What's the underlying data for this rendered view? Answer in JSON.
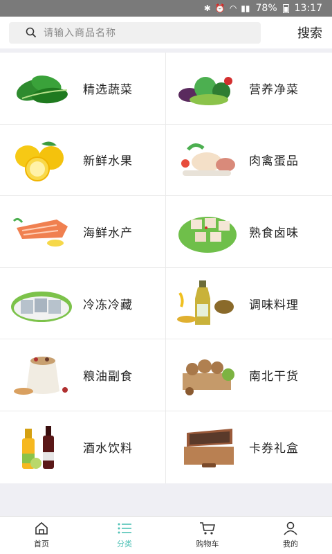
{
  "status_bar": {
    "battery": "78%",
    "time": "13:17"
  },
  "search": {
    "placeholder": "请输入商品名称",
    "button_label": "搜索"
  },
  "categories": [
    {
      "label": "精选蔬菜",
      "icon": "spinach-icon"
    },
    {
      "label": "营养净菜",
      "icon": "mixed-vegetables-icon"
    },
    {
      "label": "新鲜水果",
      "icon": "lemon-icon"
    },
    {
      "label": "肉禽蛋品",
      "icon": "poultry-icon"
    },
    {
      "label": "海鲜水产",
      "icon": "salmon-icon"
    },
    {
      "label": "熟食卤味",
      "icon": "tofu-icon"
    },
    {
      "label": "冷冻冷藏",
      "icon": "frozen-fish-icon"
    },
    {
      "label": "调味料理",
      "icon": "oil-bottle-icon"
    },
    {
      "label": "粮油副食",
      "icon": "grain-sack-icon"
    },
    {
      "label": "南北干货",
      "icon": "walnut-icon"
    },
    {
      "label": "酒水饮料",
      "icon": "bottles-icon"
    },
    {
      "label": "卡券礼盒",
      "icon": "gift-box-icon"
    }
  ],
  "tabbar": {
    "items": [
      {
        "label": "首页",
        "icon": "home-icon"
      },
      {
        "label": "分类",
        "icon": "list-icon",
        "active": true
      },
      {
        "label": "购物车",
        "icon": "cart-icon"
      },
      {
        "label": "我的",
        "icon": "user-icon"
      }
    ]
  },
  "colors": {
    "accent": "#4fc1b6",
    "status_bar": "#7a7a7a"
  }
}
